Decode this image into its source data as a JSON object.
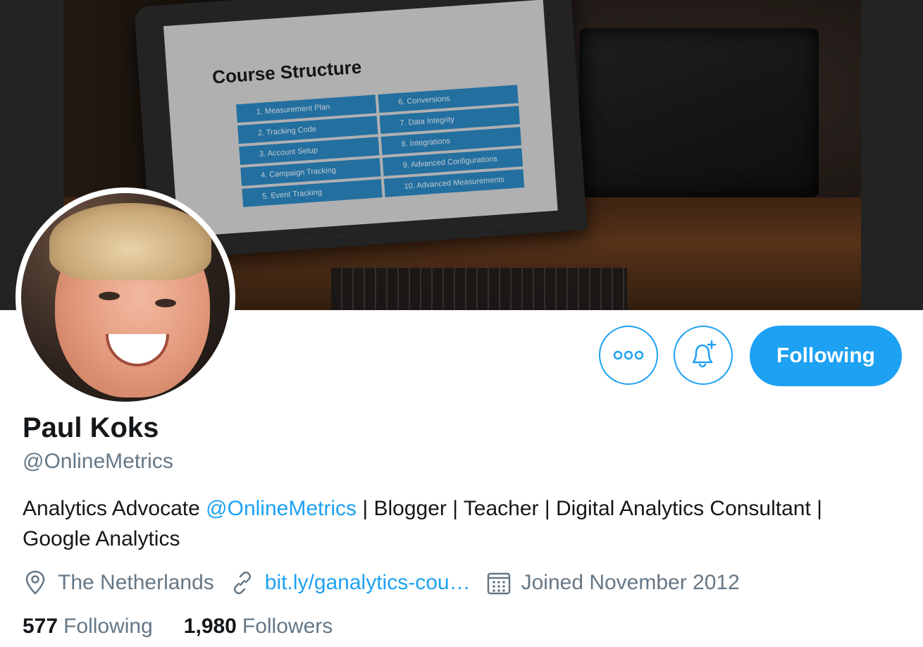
{
  "banner": {
    "slide_title": "Course Structure",
    "slide_items": [
      "1. Measurement Plan",
      "6. Conversions",
      "2. Tracking Code",
      "7. Data Integrity",
      "3. Account Setup",
      "8. Integrations",
      "4. Campaign Tracking",
      "9. Advanced Configurations",
      "5. Event Tracking",
      "10. Advanced Measurements"
    ],
    "slide_footer_prefix": "ll have",
    "slide_footer_bold": "lifetime access",
    "slide_footer_suffix": "to current and newly added course lectures."
  },
  "actions": {
    "more_icon": "more-dots-icon",
    "notify_icon": "bell-plus-icon",
    "following_label": "Following"
  },
  "profile": {
    "name": "Paul Koks",
    "handle": "@OnlineMetrics",
    "bio_prefix": "Analytics Advocate ",
    "bio_mention": "@OnlineMetrics",
    "bio_suffix": " | Blogger | Teacher | Digital Analytics Consultant | Google Analytics",
    "location": "The Netherlands",
    "location_icon": "location-pin-icon",
    "website": "bit.ly/ganalytics-cou…",
    "website_icon": "link-icon",
    "joined": "Joined November 2012",
    "joined_icon": "calendar-icon"
  },
  "stats": {
    "following_count": "577",
    "following_label": "Following",
    "followers_count": "1,980",
    "followers_label": "Followers"
  },
  "colors": {
    "accent": "#1da1f2",
    "secondary_text": "#657786",
    "primary_text": "#14171a"
  }
}
